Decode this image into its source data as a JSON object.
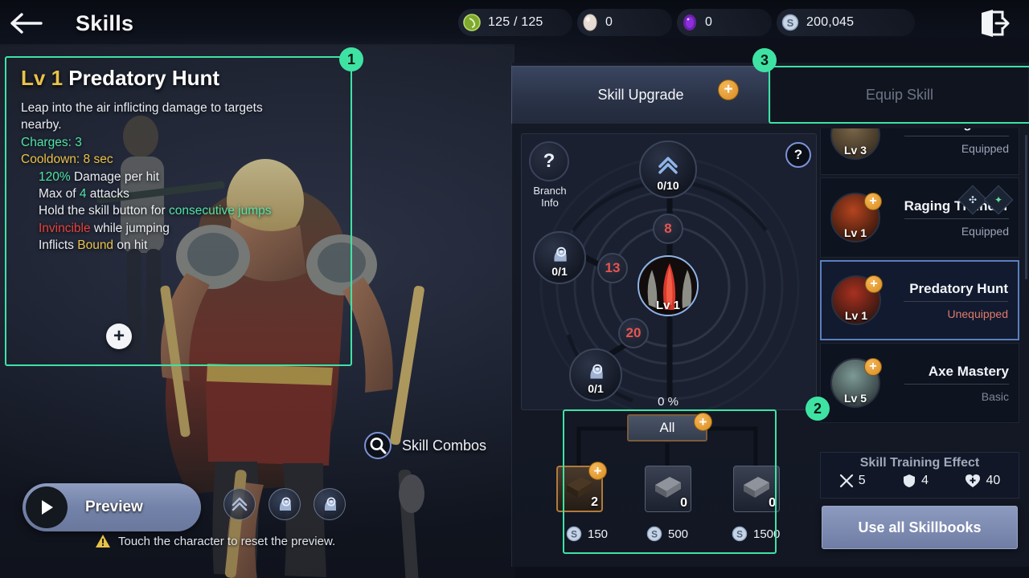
{
  "header": {
    "back_icon": "arrow-left-icon",
    "title": "Skills",
    "exit_icon": "exit-door-icon",
    "currencies": [
      {
        "icon": "stamina-leaf-icon",
        "value": "125 / 125"
      },
      {
        "icon": "pearl-icon",
        "value": "0"
      },
      {
        "icon": "purple-gem-icon",
        "value": "0"
      },
      {
        "icon": "silver-coin-icon",
        "value": "200,045"
      }
    ]
  },
  "highlights": [
    {
      "label": "1",
      "target": "skill-description-panel"
    },
    {
      "label": "2",
      "target": "skillbook-purchase-panel"
    },
    {
      "label": "3",
      "target": "equip-skill-tab"
    }
  ],
  "skill_description": {
    "level_prefix": "Lv 1",
    "name": "Predatory Hunt",
    "summary_line1": "Leap into the air inflicting damage to targets",
    "summary_line2": "nearby.",
    "charges_label": "Charges: 3",
    "cooldown_label": "Cooldown: 8 sec",
    "effects": [
      {
        "value": "120%",
        "value_color": "green",
        "text": " Damage per hit"
      },
      {
        "pre": "Max of ",
        "value": "4",
        "value_color": "green",
        "text": " attacks"
      },
      {
        "pre": "Hold the skill button for ",
        "value": "consecutive jumps",
        "value_color": "green",
        "text": ""
      },
      {
        "value": "Invincible",
        "value_color": "red",
        "text": " while jumping"
      },
      {
        "pre": "Inflicts ",
        "value": "Bound",
        "value_color": "gold",
        "text": " on hit"
      }
    ],
    "expand_icon": "plus-icon"
  },
  "left_controls": {
    "combos_icon": "search-icon",
    "combos_label": "Skill Combos",
    "preview_icon": "play-icon",
    "preview_label": "Preview",
    "mini_skills": [
      {
        "icon": "double-chevron-up-icon"
      },
      {
        "icon": "head-focus-icon"
      },
      {
        "icon": "head-focus-icon"
      }
    ],
    "hint_icon": "warning-icon",
    "hint_text": "Touch the character to reset the preview."
  },
  "tabs": [
    {
      "id": "skill-upgrade",
      "label": "Skill Upgrade",
      "active": true,
      "has_plus": true,
      "plus": "+"
    },
    {
      "id": "equip-skill",
      "label": "Equip Skill",
      "active": false,
      "has_plus": false
    }
  ],
  "wheel": {
    "branch_info_icon": "question-diamond-icon",
    "branch_info_label_1": "Branch",
    "branch_info_label_2": "Info",
    "help_icon": "question-mark-icon",
    "help_label": "?",
    "center": {
      "level_label": "Lv 1",
      "icon": "predatory-hunt-icon"
    },
    "progress_percent": "0 %",
    "nodes": [
      {
        "id": "node-top",
        "icon": "double-chevron-up-icon",
        "value": "0/10"
      },
      {
        "id": "node-left",
        "icon": "head-focus-icon",
        "value": "0/1"
      },
      {
        "id": "node-bottom-left",
        "icon": "head-focus-icon",
        "value": "0/1"
      }
    ],
    "costs": [
      {
        "id": "cost-top",
        "value": "8"
      },
      {
        "id": "cost-mid",
        "value": "13"
      },
      {
        "id": "cost-low",
        "value": "20"
      }
    ]
  },
  "skillbooks": {
    "all_label": "All",
    "all_plus": "+",
    "items": [
      {
        "id": "book-basic",
        "icon": "brown-book-icon",
        "qty": "2",
        "price": "150",
        "price_icon": "silver-coin-icon",
        "selected": true,
        "has_plus": true,
        "plus": "+"
      },
      {
        "id": "book-advanced",
        "icon": "grey-book-icon",
        "qty": "0",
        "price": "500",
        "price_icon": "silver-coin-icon",
        "selected": false,
        "has_plus": false
      },
      {
        "id": "book-rare",
        "icon": "grey-book-icon",
        "qty": "0",
        "price": "1500",
        "price_icon": "silver-coin-icon",
        "selected": false,
        "has_plus": false
      }
    ]
  },
  "skill_list": [
    {
      "id": "falling-rock",
      "level": "Lv 3",
      "name": "Falling Rock",
      "status": "Equipped",
      "status_kind": "eq",
      "selected": false,
      "has_plus": false,
      "tags": [],
      "icon_color": "#6b5a3e"
    },
    {
      "id": "raging-thunder",
      "level": "Lv 1",
      "name": "Raging Thunder",
      "status": "Equipped",
      "status_kind": "eq",
      "selected": false,
      "has_plus": true,
      "plus": "+",
      "tags": [
        "tag-cluster-icon",
        "tag-burst-icon"
      ],
      "icon_color": "#8c2f1a"
    },
    {
      "id": "predatory-hunt",
      "level": "Lv 1",
      "name": "Predatory Hunt",
      "status": "Unequipped",
      "status_kind": "uneq",
      "selected": true,
      "has_plus": true,
      "plus": "+",
      "tags": [],
      "icon_color": "#8a2218"
    },
    {
      "id": "axe-mastery",
      "level": "Lv 5",
      "name": "Axe Mastery",
      "status": "Basic",
      "status_kind": "basic",
      "selected": false,
      "has_plus": true,
      "plus": "+",
      "tags": [],
      "icon_color": "#5d7d7a"
    }
  ],
  "training_effect": {
    "title": "Skill Training Effect",
    "stats": [
      {
        "icon": "swords-icon",
        "value": "5"
      },
      {
        "icon": "shield-icon",
        "value": "4"
      },
      {
        "icon": "health-icon",
        "value": "40"
      }
    ]
  },
  "use_all_button": {
    "label": "Use all Skillbooks"
  },
  "colors": {
    "accent_green": "#3ee3a4",
    "accent_gold": "#e8c24a",
    "accent_red": "#e8413c",
    "cost_red": "#e8544f",
    "panel_bg": "#151a26",
    "selected_border": "#5a7fc0"
  }
}
